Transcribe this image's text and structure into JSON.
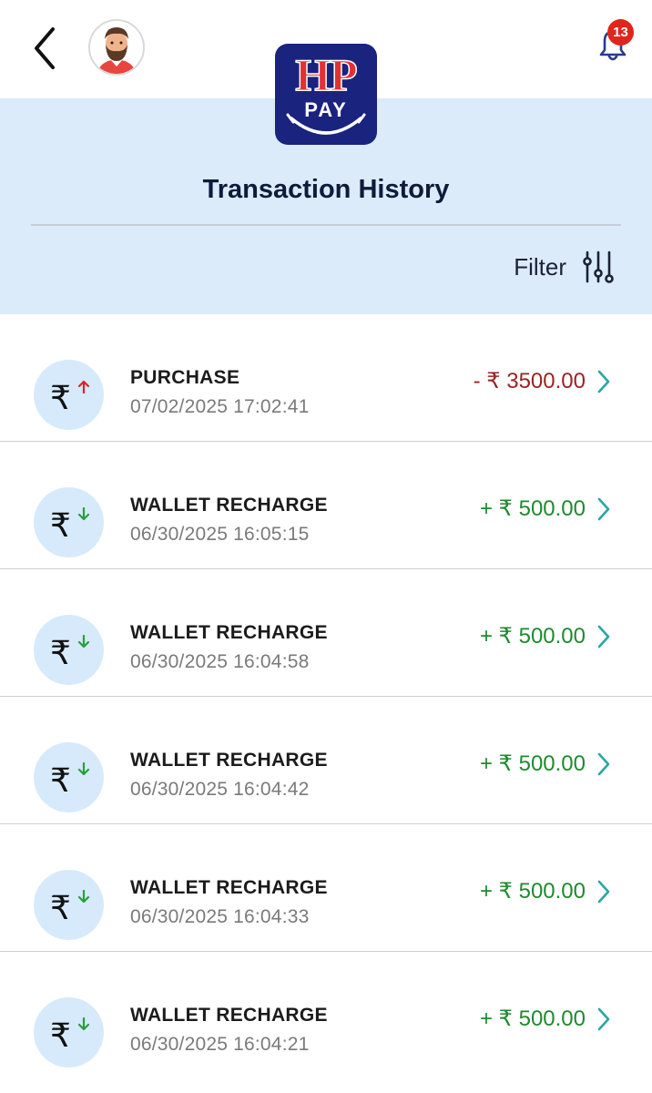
{
  "header": {
    "title": "Transaction History",
    "filter_label": "Filter",
    "notification_count": "13"
  },
  "logo": {
    "line1": "HP",
    "line2": "PAY"
  },
  "colors": {
    "header_bg": "#dbebfa",
    "logo_bg": "#1a237e",
    "logo_red": "#e23131",
    "debit": "#9b2323",
    "credit": "#1f8a2e",
    "chevron": "#2aa6a3",
    "badge": "#e0251b"
  },
  "transactions": [
    {
      "type": "PURCHASE",
      "datetime": "07/02/2025 17:02:41",
      "amount": "- ₹ 3500.00",
      "direction": "debit"
    },
    {
      "type": "WALLET RECHARGE",
      "datetime": "06/30/2025 16:05:15",
      "amount": "+ ₹ 500.00",
      "direction": "credit"
    },
    {
      "type": "WALLET RECHARGE",
      "datetime": "06/30/2025 16:04:58",
      "amount": "+ ₹ 500.00",
      "direction": "credit"
    },
    {
      "type": "WALLET RECHARGE",
      "datetime": "06/30/2025 16:04:42",
      "amount": "+ ₹ 500.00",
      "direction": "credit"
    },
    {
      "type": "WALLET RECHARGE",
      "datetime": "06/30/2025 16:04:33",
      "amount": "+ ₹ 500.00",
      "direction": "credit"
    },
    {
      "type": "WALLET RECHARGE",
      "datetime": "06/30/2025 16:04:21",
      "amount": "+ ₹ 500.00",
      "direction": "credit"
    }
  ],
  "icons": {
    "back": "back-arrow-icon",
    "bell": "notification-bell-icon",
    "filter": "filter-sliders-icon",
    "row": "rupee-icon",
    "chevron": "chevron-right-icon"
  }
}
